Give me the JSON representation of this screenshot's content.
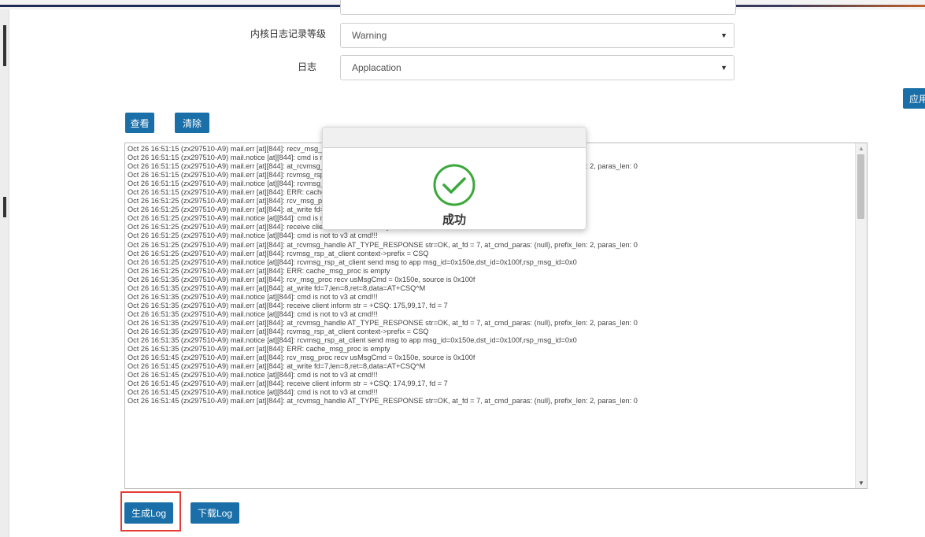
{
  "form": {
    "kernel_log_level_label": "内核日志记录等级",
    "kernel_log_level_value": "Warning",
    "log_label": "日志",
    "log_value": "Applacation"
  },
  "buttons": {
    "view": "查看",
    "clear": "清除",
    "apply": "应用",
    "generate_log": "生成Log",
    "download_log": "下载Log"
  },
  "modal": {
    "message": "成功",
    "icon": "check-circle-icon",
    "icon_color": "#3aa83a"
  },
  "colors": {
    "primary": "#1a6fa8",
    "highlight": "#e53935"
  },
  "log": {
    "lines": [
      "Oct 26 16:51:15 (zx297510-A9) mail.err [at][844]: recv_msg_proc recv usMsgCmd = 0x150e, source is 0x100f",
      "Oct 26 16:51:15 (zx297510-A9) mail.notice [at][844]: cmd is not to v3 at cmd!!!",
      "Oct 26 16:51:15 (zx297510-A9) mail.err [at][844]: at_rcvmsg_handle AT_TYPE_RESPONSE str=OK, at_fd = 7, at_cmd_paras: (null), prefix_len: 2, paras_len: 0",
      "Oct 26 16:51:15 (zx297510-A9) mail.err [at][844]: rcvmsg_rsp_at_client context->prefix = CSQ",
      "Oct 26 16:51:15 (zx297510-A9) mail.notice [at][844]: rcvmsg_rsp_at_client send msg to app msg_id=0x150e,dst_id=0x100f,rsp_msg_id=0x0",
      "Oct 26 16:51:15 (zx297510-A9) mail.err [at][844]: ERR: cache_msg_proc is empty",
      "Oct 26 16:51:25 (zx297510-A9) mail.err [at][844]: rcv_msg_proc recv usMsgCmd = 0x150e, source is 0x100f",
      "Oct 26 16:51:25 (zx297510-A9) mail.err [at][844]: at_write fd=7,len=8,ret=8,data=AT+CSQ^M",
      "Oct 26 16:51:25 (zx297510-A9) mail.notice [at][844]: cmd is not to v3 at cmd!!!",
      "Oct 26 16:51:25 (zx297510-A9) mail.err [at][844]: receive client inform str = +CSQ: 175,99,17, fd = 7",
      "Oct 26 16:51:25 (zx297510-A9) mail.notice [at][844]: cmd is not to v3 at cmd!!!",
      "Oct 26 16:51:25 (zx297510-A9) mail.err [at][844]: at_rcvmsg_handle AT_TYPE_RESPONSE str=OK, at_fd = 7, at_cmd_paras: (null), prefix_len: 2, paras_len: 0",
      "Oct 26 16:51:25 (zx297510-A9) mail.err [at][844]: rcvmsg_rsp_at_client context->prefix = CSQ",
      "Oct 26 16:51:25 (zx297510-A9) mail.notice [at][844]: rcvmsg_rsp_at_client send msg to app msg_id=0x150e,dst_id=0x100f,rsp_msg_id=0x0",
      "Oct 26 16:51:25 (zx297510-A9) mail.err [at][844]: ERR: cache_msg_proc is empty",
      "Oct 26 16:51:35 (zx297510-A9) mail.err [at][844]: rcv_msg_proc recv usMsgCmd = 0x150e, source is 0x100f",
      "Oct 26 16:51:35 (zx297510-A9) mail.err [at][844]: at_write fd=7,len=8,ret=8,data=AT+CSQ^M",
      "Oct 26 16:51:35 (zx297510-A9) mail.notice [at][844]: cmd is not to v3 at cmd!!!",
      "Oct 26 16:51:35 (zx297510-A9) mail.err [at][844]: receive client inform str = +CSQ: 175,99,17, fd = 7",
      "Oct 26 16:51:35 (zx297510-A9) mail.notice [at][844]: cmd is not to v3 at cmd!!!",
      "Oct 26 16:51:35 (zx297510-A9) mail.err [at][844]: at_rcvmsg_handle AT_TYPE_RESPONSE str=OK, at_fd = 7, at_cmd_paras: (null), prefix_len: 2, paras_len: 0",
      "Oct 26 16:51:35 (zx297510-A9) mail.err [at][844]: rcvmsg_rsp_at_client context->prefix = CSQ",
      "Oct 26 16:51:35 (zx297510-A9) mail.notice [at][844]: rcvmsg_rsp_at_client send msg to app msg_id=0x150e,dst_id=0x100f,rsp_msg_id=0x0",
      "Oct 26 16:51:35 (zx297510-A9) mail.err [at][844]: ERR: cache_msg_proc is empty",
      "Oct 26 16:51:45 (zx297510-A9) mail.err [at][844]: rcv_msg_proc recv usMsgCmd = 0x150e, source is 0x100f",
      "Oct 26 16:51:45 (zx297510-A9) mail.err [at][844]: at_write fd=7,len=8,ret=8,data=AT+CSQ^M",
      "Oct 26 16:51:45 (zx297510-A9) mail.notice [at][844]: cmd is not to v3 at cmd!!!",
      "Oct 26 16:51:45 (zx297510-A9) mail.err [at][844]: receive client inform str = +CSQ: 174,99,17, fd = 7",
      "Oct 26 16:51:45 (zx297510-A9) mail.notice [at][844]: cmd is not to v3 at cmd!!!",
      "Oct 26 16:51:45 (zx297510-A9) mail.err [at][844]: at_rcvmsg_handle AT_TYPE_RESPONSE str=OK, at_fd = 7, at_cmd_paras: (null), prefix_len: 2, paras_len: 0"
    ]
  }
}
